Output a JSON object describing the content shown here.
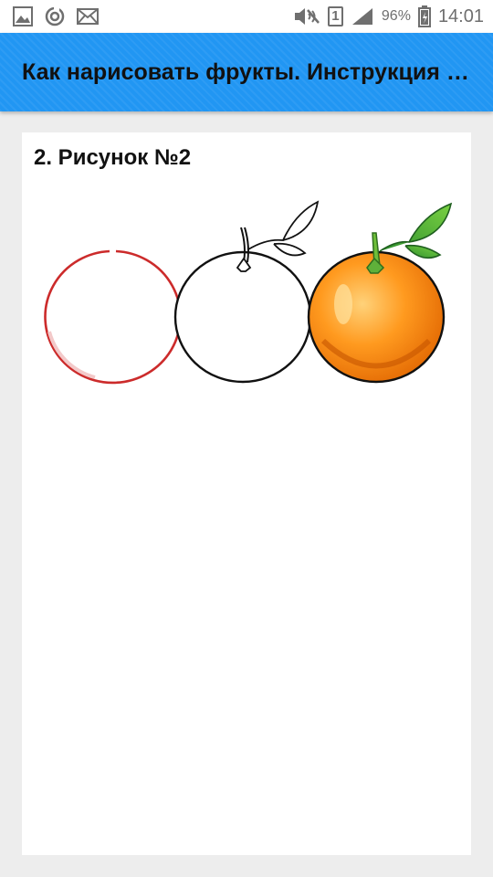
{
  "status_bar": {
    "icons_left": [
      "gallery-icon",
      "sync-icon",
      "mail-icon"
    ],
    "icons_right": [
      "mute-icon",
      "sim-icon",
      "signal-icon",
      "battery-icon"
    ],
    "sim_label": "1",
    "battery": "96%",
    "time": "14:01"
  },
  "app_bar": {
    "title": "Как нарисовать фрукты. Инструкция по рисованию",
    "color": "#2196f3"
  },
  "content": {
    "heading": "2. Рисунок №2",
    "illustration": {
      "steps": [
        "red-circle-outline",
        "orange-line-drawing",
        "colored-orange"
      ],
      "colors": {
        "circle": "#cc2b2b",
        "orange_fill": "#ff8c1a",
        "leaf": "#3aa53a"
      }
    }
  }
}
